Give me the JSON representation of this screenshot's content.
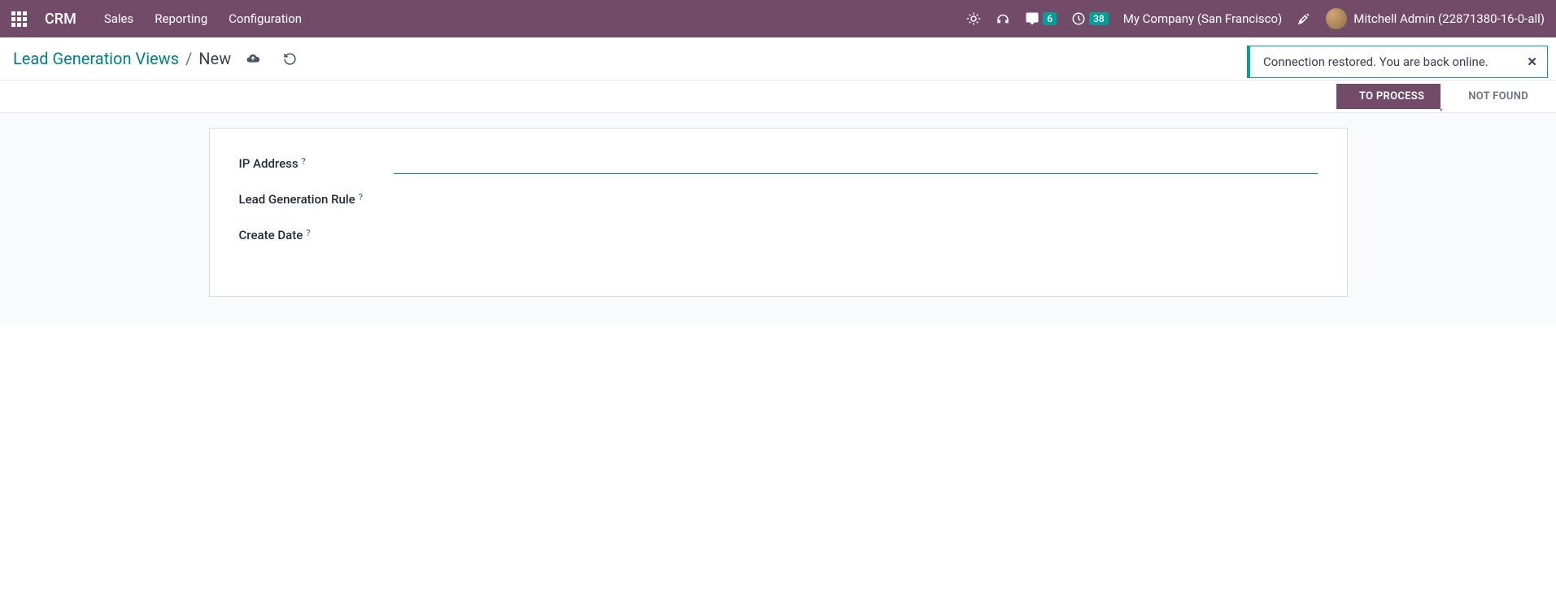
{
  "header": {
    "brand": "CRM",
    "menu": [
      "Sales",
      "Reporting",
      "Configuration"
    ],
    "messages_badge": "6",
    "activities_badge": "38",
    "company": "My Company (San Francisco)",
    "user": "Mitchell Admin (22871380-16-0-all)"
  },
  "breadcrumb": {
    "parent": "Lead Generation Views",
    "separator": "/",
    "current": "New"
  },
  "notification": {
    "text": "Connection restored. You are back online."
  },
  "status": {
    "active": "TO PROCESS",
    "inactive": "NOT FOUND"
  },
  "form": {
    "fields": [
      {
        "label": "IP Address",
        "help": "?",
        "value": "",
        "focused": true
      },
      {
        "label": "Lead Generation Rule",
        "help": "?",
        "value": "",
        "focused": false
      },
      {
        "label": "Create Date",
        "help": "?",
        "value": "",
        "focused": false
      }
    ]
  }
}
